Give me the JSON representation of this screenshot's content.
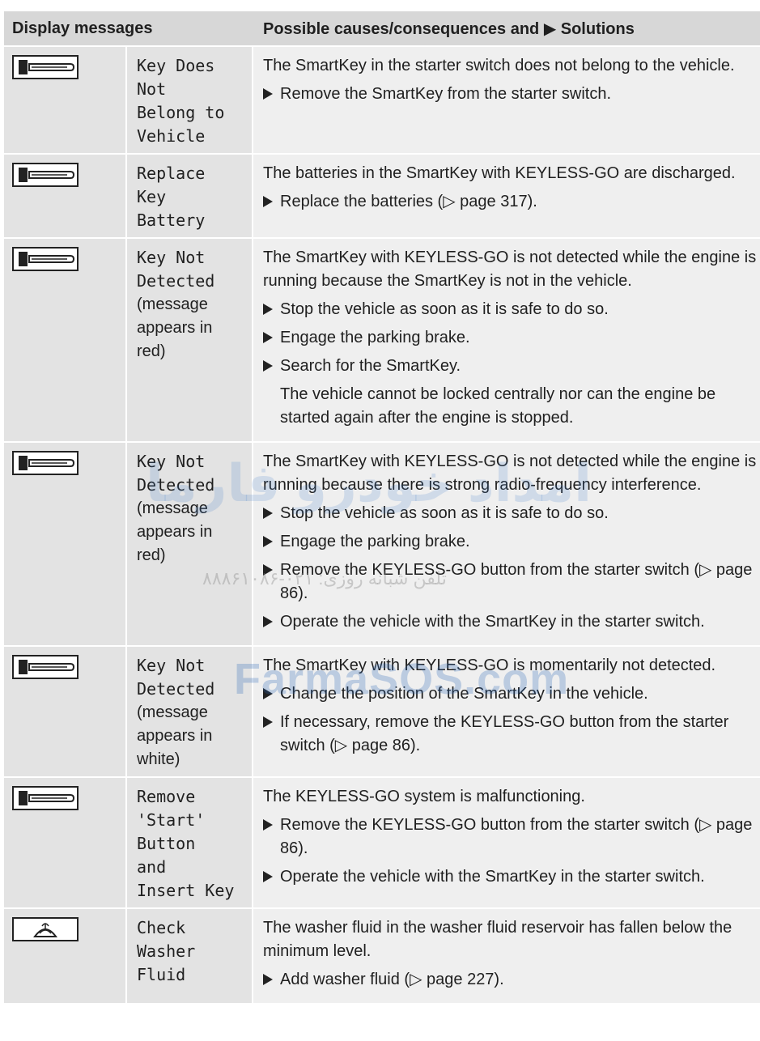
{
  "header": {
    "col1": "Display messages",
    "col2": "Possible causes/consequences and ▶ Solutions"
  },
  "rows": [
    {
      "icon": "key-icon",
      "message_lines": [
        "Key Does",
        "Not",
        "Belong to",
        "Vehicle"
      ],
      "content": [
        {
          "type": "para",
          "text": "The SmartKey in the starter switch does not belong to the vehicle."
        },
        {
          "type": "step",
          "text": "Remove the SmartKey from the starter switch."
        }
      ]
    },
    {
      "icon": "key-icon",
      "message_lines": [
        "Replace",
        "Key",
        "Battery"
      ],
      "content": [
        {
          "type": "para",
          "text": "The batteries in the SmartKey with KEYLESS-GO are discharged."
        },
        {
          "type": "step",
          "text": "Replace the batteries (▷ page 317)."
        }
      ]
    },
    {
      "icon": "key-icon",
      "message_lines": [
        "Key Not",
        "Detected"
      ],
      "message_note_lines": [
        "(message",
        "appears in",
        "red)"
      ],
      "content": [
        {
          "type": "para",
          "text": "The SmartKey with KEYLESS-GO is not detected while the engine is running because the SmartKey is not in the vehicle."
        },
        {
          "type": "step",
          "text": "Stop the vehicle as soon as it is safe to do so."
        },
        {
          "type": "step",
          "text": "Engage the parking brake."
        },
        {
          "type": "step",
          "text": "Search for the SmartKey."
        },
        {
          "type": "note",
          "text": "The vehicle cannot be locked centrally nor can the engine be started again after the engine is stopped."
        }
      ]
    },
    {
      "icon": "key-icon",
      "message_lines": [
        "Key Not",
        "Detected"
      ],
      "message_note_lines": [
        "(message",
        "appears in",
        "red)"
      ],
      "content": [
        {
          "type": "para",
          "text": "The SmartKey with KEYLESS-GO is not detected while the engine is running because there is strong radio-frequency interference."
        },
        {
          "type": "step",
          "text": "Stop the vehicle as soon as it is safe to do so."
        },
        {
          "type": "step",
          "text": "Engage the parking brake."
        },
        {
          "type": "step",
          "text": "Remove the KEYLESS-GO button from the starter switch (▷ page 86)."
        },
        {
          "type": "step",
          "text": "Operate the vehicle with the SmartKey in the starter switch."
        }
      ]
    },
    {
      "icon": "key-icon",
      "message_lines": [
        "Key Not",
        "Detected"
      ],
      "message_note_lines": [
        "(message",
        "appears in",
        "white)"
      ],
      "content": [
        {
          "type": "para",
          "text": "The SmartKey with KEYLESS-GO is momentarily not detected."
        },
        {
          "type": "step",
          "text": "Change the position of the SmartKey in the vehicle."
        },
        {
          "type": "step",
          "text": "If necessary, remove the KEYLESS-GO button from the starter switch (▷ page 86)."
        }
      ]
    },
    {
      "icon": "key-icon",
      "message_lines": [
        "Remove",
        "'Start'",
        "Button",
        "and",
        "Insert Key"
      ],
      "content": [
        {
          "type": "para",
          "text": "The KEYLESS-GO system is malfunctioning."
        },
        {
          "type": "step",
          "text": "Remove the KEYLESS-GO button from the starter switch (▷ page 86)."
        },
        {
          "type": "step",
          "text": "Operate the vehicle with the SmartKey in the starter switch."
        }
      ]
    },
    {
      "icon": "washer-fluid-icon",
      "message_lines": [
        "Check",
        "Washer",
        "Fluid"
      ],
      "content": [
        {
          "type": "para",
          "text": "The washer fluid in the washer fluid reservoir has fallen below the minimum level."
        },
        {
          "type": "step",
          "text": "Add washer fluid (▷ page 227)."
        }
      ]
    }
  ],
  "watermark": {
    "persian_large": "امداد خودرو فارما",
    "phone_text": "تلفن شبانه روزی: ۰۲۱-۸۸۸۶۱۰۸۶",
    "site": "FarmaSOS.com"
  }
}
